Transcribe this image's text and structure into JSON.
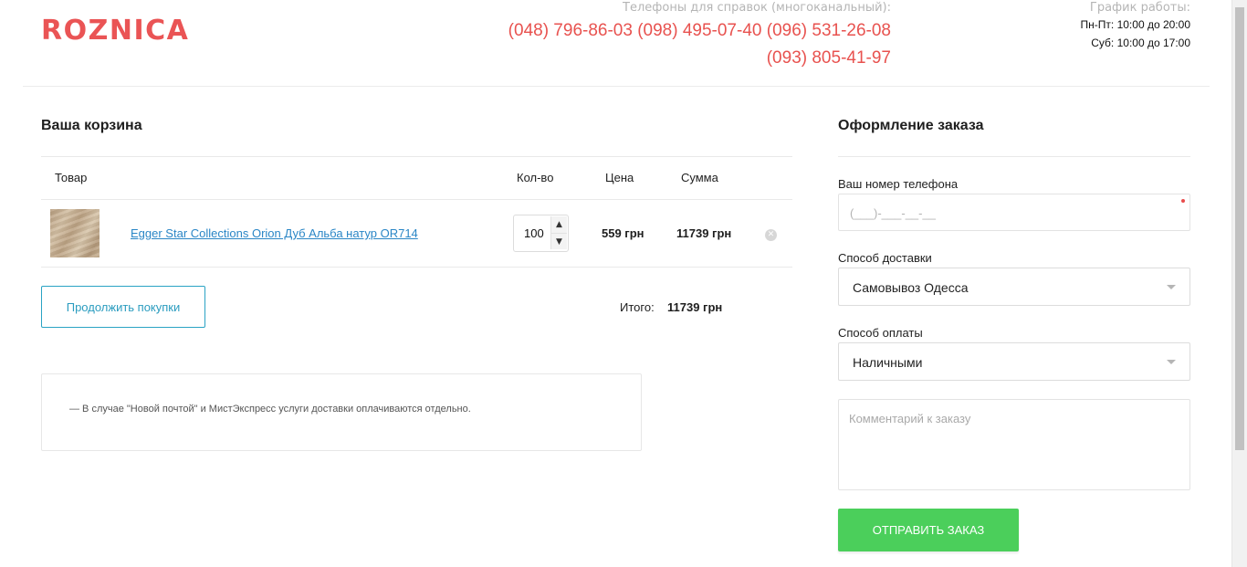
{
  "header": {
    "logo": "ROZNICA",
    "phones_caption": "Телефоны для справок (многоканальный):",
    "phones_line1": "(048) 796-86-03 (098) 495-07-40 (096) 531-26-08",
    "phones_line2": "(093) 805-41-97",
    "schedule_caption": "График работы:",
    "schedule_weekdays": "Пн-Пт: 10:00 до 20:00",
    "schedule_saturday": "Суб: 10:00 до 17:00"
  },
  "cart": {
    "title": "Ваша корзина",
    "columns": {
      "product": "Товар",
      "qty": "Кол-во",
      "price": "Цена",
      "sum": "Сумма"
    },
    "items": [
      {
        "name": "Egger Star Collections Orion Дуб Альба натур OR714",
        "qty": "100",
        "price": "559 грн",
        "sum": "11739 грн",
        "remove_icon": "close-circle-icon"
      }
    ],
    "continue_label": "Продолжить покупки",
    "total_label": "Итого:",
    "total_value": "11739 грн",
    "note": "— В случае \"Новой почтой\" и МистЭкспресс услуги доставки оплачиваются отдельно."
  },
  "order": {
    "title": "Оформление заказа",
    "phone_label": "Ваш номер телефона",
    "phone_placeholder": "(___)-___-__-__",
    "delivery_label": "Способ доставки",
    "delivery_value": "Самовывоз Одесса",
    "payment_label": "Способ оплаты",
    "payment_value": "Наличными",
    "comment_placeholder": "Комментарий к заказу",
    "submit_label": "ОТПРАВИТЬ ЗАКАЗ"
  },
  "colors": {
    "brand": "#ea5455",
    "link": "#2a86c6",
    "continue_border": "#2aa3c4",
    "submit": "#4bcf5b"
  }
}
